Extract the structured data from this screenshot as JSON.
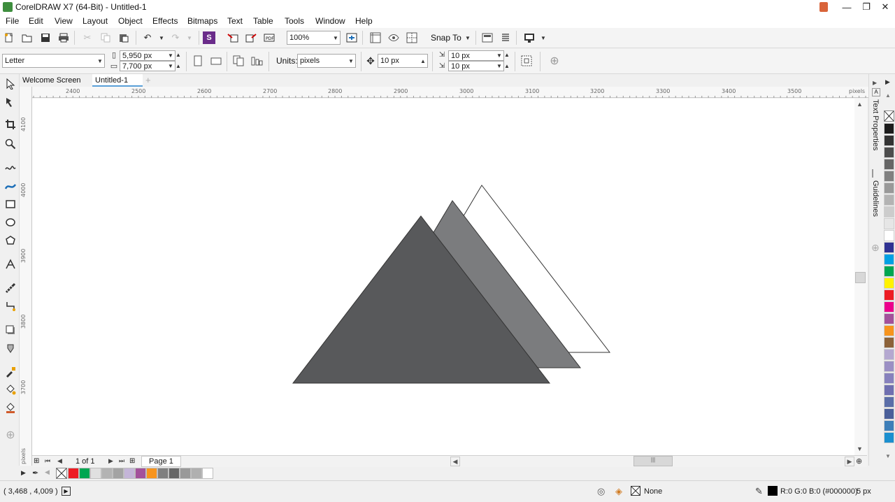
{
  "window": {
    "title": "CorelDRAW X7 (64-Bit) - Untitled-1",
    "minimize_glyph": "—",
    "restore_glyph": "❐",
    "close_glyph": "✕"
  },
  "menu": [
    "File",
    "Edit",
    "View",
    "Layout",
    "Object",
    "Effects",
    "Bitmaps",
    "Text",
    "Table",
    "Tools",
    "Window",
    "Help"
  ],
  "standard_toolbar": {
    "zoom_value": "100%",
    "snap_to_label": "Snap To"
  },
  "property_bar": {
    "page_size": "Letter",
    "width": "5,950 px",
    "height": "7,700 px",
    "units_label": "Units:",
    "units_value": "pixels",
    "nudge": "10 px",
    "dup_x": "10 px",
    "dup_y": "10 px"
  },
  "tabs": [
    {
      "label": "Welcome Screen",
      "active": false
    },
    {
      "label": "Untitled-1",
      "active": true
    }
  ],
  "ruler": {
    "unit": "pixels",
    "h_ticks": [
      "2400",
      "2500",
      "2600",
      "2700",
      "2800",
      "2900",
      "3000",
      "3100",
      "3200",
      "3300",
      "3400",
      "3500"
    ],
    "v_ticks": [
      "4100",
      "4000",
      "3900",
      "3800",
      "3700"
    ],
    "v_unit": "pixels"
  },
  "dockers": [
    "Text Properties",
    "Guidelines"
  ],
  "page_nav": {
    "page_count": "1 of 1",
    "page_tab": "Page 1"
  },
  "shapes": [
    {
      "name": "white-triangle",
      "fill": "#ffffff",
      "stroke": "#333333"
    },
    {
      "name": "gray-triangle",
      "fill": "#7b7c7e",
      "stroke": "#333333"
    },
    {
      "name": "dark-triangle",
      "fill": "#58595b",
      "stroke": "#333333"
    }
  ],
  "palette_vertical": [
    "#1c1c1c",
    "#333333",
    "#4d4d4d",
    "#666666",
    "#808080",
    "#999999",
    "#b3b3b3",
    "#cccccc",
    "#e6e6e6",
    "#ffffff",
    "#2e3192",
    "#00a0e3",
    "#00a651",
    "#fff200",
    "#ed1c24",
    "#ec008c",
    "#a3519b",
    "#f7941d",
    "#8c6239",
    "#b4a8d0",
    "#9b8fc4",
    "#8781bd",
    "#6f6fb0",
    "#5b6ea8",
    "#4a5f9a",
    "#3d7eb8",
    "#1b8fcf"
  ],
  "palette_document": [
    "#ed1c24",
    "#00a651",
    "#e0e0e0",
    "#b3b3b3",
    "#a3a3a3",
    "#c4b5d8",
    "#a3519b",
    "#f7941d",
    "#808080",
    "#666666",
    "#999999",
    "#b0b0b0",
    "#ffffff"
  ],
  "status": {
    "coordinates": "( 3,468 , 4,009 )",
    "fill_label": "None",
    "outline_color": "R:0 G:0 B:0 (#000000)",
    "outline_width": "5 px"
  }
}
